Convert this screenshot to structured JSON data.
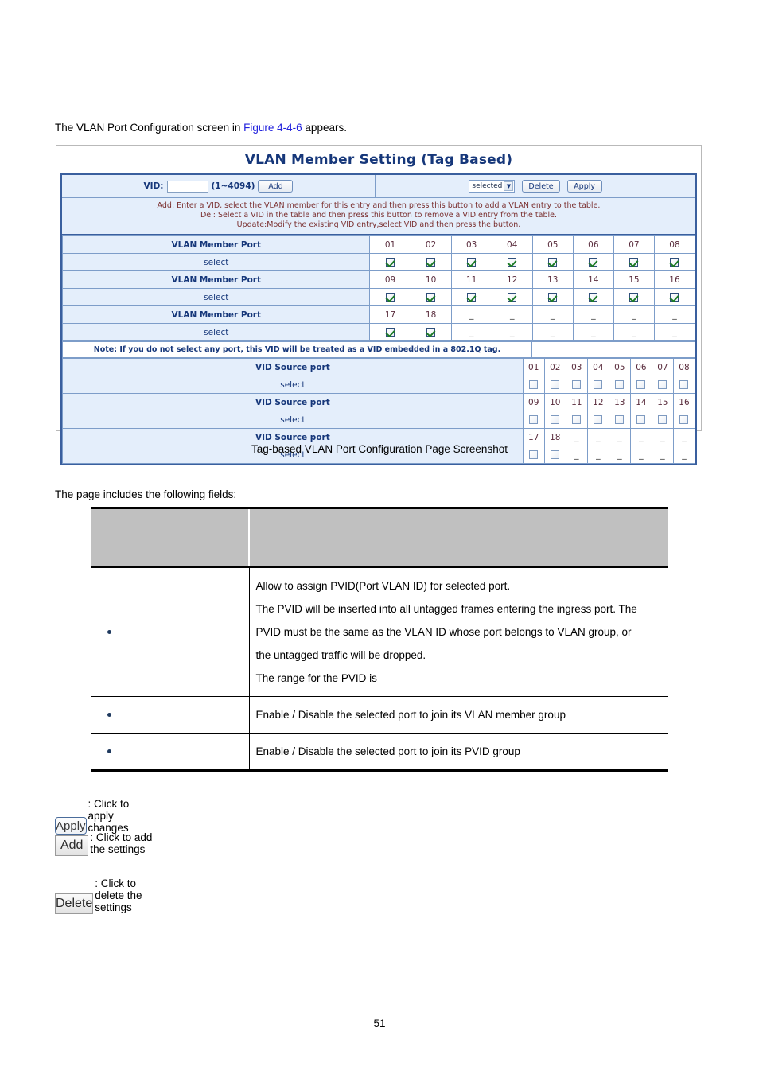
{
  "intro": {
    "before": "The VLAN Port Configuration screen in ",
    "link": "Figure 4-4-6",
    "after": " appears."
  },
  "screenshot": {
    "title": "VLAN Member Setting (Tag Based)",
    "commandbar": {
      "vid_label": "VID:",
      "vid_value": "",
      "vid_placeholder": "",
      "range_hint": "(1~4094)",
      "add_label": "Add",
      "select_value": "selected",
      "select_arrow": "▼",
      "delete_label": "Delete",
      "apply_label": "Apply"
    },
    "help_lines": [
      "Add: Enter a VID, select the VLAN member for this entry and then press this button to add a VLAN entry to the table.",
      "Del: Select a VID in the table and then press this button to remove a VID entry from the table.",
      "Update:Modify the existing VID entry,select VID and then press the button."
    ],
    "member_label": "VLAN Member Port",
    "select_label": "select",
    "source_label": "VID Source port",
    "dash": "_",
    "note": "Note: If you do not select any port, this VID will be treated as a VID embedded in a 802.1Q tag.",
    "member_rows": [
      {
        "ports": [
          "01",
          "02",
          "03",
          "04",
          "05",
          "06",
          "07",
          "08"
        ],
        "checked": [
          true,
          true,
          true,
          true,
          true,
          true,
          true,
          true
        ]
      },
      {
        "ports": [
          "09",
          "10",
          "11",
          "12",
          "13",
          "14",
          "15",
          "16"
        ],
        "checked": [
          true,
          true,
          true,
          true,
          true,
          true,
          true,
          true
        ]
      },
      {
        "ports": [
          "17",
          "18",
          "_",
          "_",
          "_",
          "_",
          "_",
          "_"
        ],
        "checked": [
          true,
          true,
          null,
          null,
          null,
          null,
          null,
          null
        ]
      }
    ],
    "source_rows": [
      {
        "ports": [
          "01",
          "02",
          "03",
          "04",
          "05",
          "06",
          "07",
          "08"
        ],
        "checked": [
          false,
          false,
          false,
          false,
          false,
          false,
          false,
          false
        ]
      },
      {
        "ports": [
          "09",
          "10",
          "11",
          "12",
          "13",
          "14",
          "15",
          "16"
        ],
        "checked": [
          false,
          false,
          false,
          false,
          false,
          false,
          false,
          false
        ]
      },
      {
        "ports": [
          "17",
          "18",
          "_",
          "_",
          "_",
          "_",
          "_",
          "_"
        ],
        "checked": [
          false,
          false,
          null,
          null,
          null,
          null,
          null,
          null
        ]
      }
    ]
  },
  "caption": "Tag-based VLAN Port Configuration Page Screenshot",
  "fields_intro": "The page includes the following fields:",
  "fields_table": {
    "header": {
      "col_a": "",
      "col_b": ""
    },
    "rows": [
      {
        "bullet": true,
        "lines": [
          "Allow to assign PVID(Port VLAN ID) for selected port.",
          "The PVID will be inserted into all untagged frames entering the ingress port. The",
          "PVID must be the same as the VLAN ID whose port belongs to VLAN group, or",
          "the untagged traffic will be dropped.",
          "The range for the PVID is"
        ]
      },
      {
        "bullet": true,
        "lines": [
          "Enable / Disable the selected port to join its VLAN member group"
        ]
      },
      {
        "bullet": true,
        "lines": [
          "Enable / Disable the selected port to join its PVID group"
        ]
      }
    ]
  },
  "legend": [
    {
      "button": "Apply",
      "style": "apply",
      "text": ": Click to apply changes"
    },
    {
      "button": "Add",
      "style": "plain",
      "text": ": Click to add the settings"
    },
    {
      "button": "Delete",
      "style": "plain",
      "text": ": Click to delete the settings"
    }
  ],
  "page_number": "51"
}
